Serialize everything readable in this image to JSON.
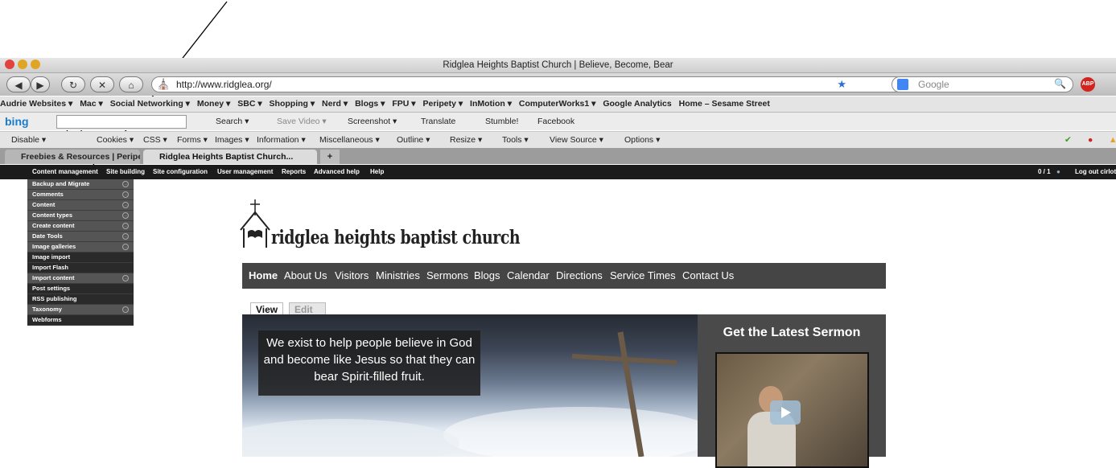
{
  "window": {
    "title": "Ridglea Heights Baptist Church | Believe, Become, Bear"
  },
  "nav": {
    "url": "http://www.ridglea.org/",
    "search_placeholder": "Google"
  },
  "bookmarks": [
    "Audrie Websites ▾",
    "Mac ▾",
    "Social Networking ▾",
    "Money ▾",
    "SBC ▾",
    "Shopping ▾",
    "Nerd ▾",
    "Blogs ▾",
    "FPU ▾",
    "Peripety ▾",
    "InMotion ▾",
    "ComputerWorks1 ▾",
    "Google Analytics",
    "Home – Sesame Street"
  ],
  "bingbar": {
    "logo": "bing",
    "items": [
      "Search ▾",
      "Save Video ▾",
      "Screenshot ▾",
      "Translate",
      "Stumble!",
      "Facebook"
    ]
  },
  "devbar": {
    "items": [
      "Disable ▾",
      "Cookies ▾",
      "CSS ▾",
      "Forms ▾",
      "Images ▾",
      "Information ▾",
      "Miscellaneous ▾",
      "Outline ▾",
      "Resize ▾",
      "Tools ▾",
      "View Source ▾",
      "Options ▾"
    ]
  },
  "tabs": [
    {
      "label": "Freebies & Resources | Peripety..."
    },
    {
      "label": "Ridglea Heights Baptist Church..."
    }
  ],
  "new_tab": "+",
  "adminbar": {
    "items": [
      "Content management",
      "Site building",
      "Site configuration",
      "User management",
      "Reports",
      "Advanced help",
      "Help"
    ],
    "counter": "0 / 1",
    "logout": "Log out cirlot"
  },
  "admin_menu": [
    {
      "label": "Backup and Migrate",
      "arrow": true
    },
    {
      "label": "Comments",
      "arrow": true
    },
    {
      "label": "Content",
      "arrow": true
    },
    {
      "label": "Content types",
      "arrow": true
    },
    {
      "label": "Create content",
      "arrow": true
    },
    {
      "label": "Date Tools",
      "arrow": true
    },
    {
      "label": "Image galleries",
      "arrow": true
    },
    {
      "label": "Image import",
      "arrow": false,
      "highlight": true
    },
    {
      "label": "Import Flash",
      "arrow": false,
      "highlight": true
    },
    {
      "label": "Import content",
      "arrow": true
    },
    {
      "label": "Post settings",
      "arrow": false,
      "highlight": true
    },
    {
      "label": "RSS publishing",
      "arrow": false,
      "highlight": true
    },
    {
      "label": "Taxonomy",
      "arrow": true
    },
    {
      "label": "Webforms",
      "arrow": false,
      "highlight": true
    }
  ],
  "site": {
    "name": "ridglea heights baptist church",
    "nav": [
      "Home",
      "About Us",
      "Visitors",
      "Ministries",
      "Sermons",
      "Blogs",
      "Calendar",
      "Directions",
      "Service Times",
      "Contact Us"
    ],
    "view_tabs": [
      "View",
      "Edit Panel"
    ],
    "tagline": "We exist to help people believe in God and become like Jesus so that they can bear Spirit-filled fruit.",
    "sermon_title": "Get the Latest Sermon"
  },
  "colors": {
    "admin_bar": "#1b1b1b",
    "site_nav": "#454545",
    "sidebar": "#4a4a4a"
  }
}
